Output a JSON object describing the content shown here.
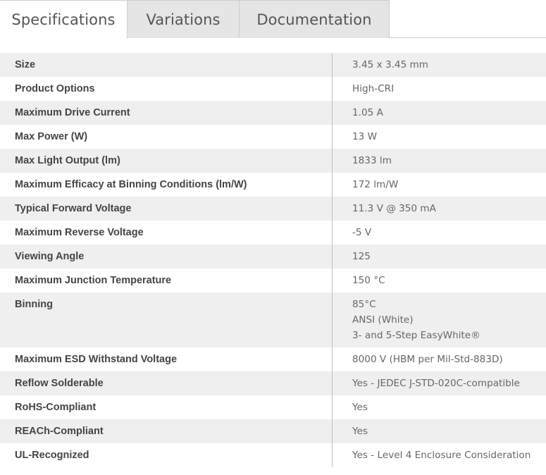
{
  "tabs": [
    {
      "label": "Specifications",
      "active": true
    },
    {
      "label": "Variations",
      "active": false
    },
    {
      "label": "Documentation",
      "active": false
    }
  ],
  "specs": [
    {
      "label": "Size",
      "values": [
        "3.45 x 3.45 mm"
      ]
    },
    {
      "label": "Product Options",
      "values": [
        "High-CRI"
      ]
    },
    {
      "label": "Maximum Drive Current",
      "values": [
        "1.05 A"
      ]
    },
    {
      "label": "Max Power (W)",
      "values": [
        "13 W"
      ]
    },
    {
      "label": "Max Light Output (lm)",
      "values": [
        "1833 lm"
      ]
    },
    {
      "label": "Maximum Efficacy at Binning Conditions (lm/W)",
      "values": [
        "172 lm/W"
      ]
    },
    {
      "label": "Typical Forward Voltage",
      "values": [
        "11.3 V @ 350 mA"
      ]
    },
    {
      "label": "Maximum Reverse Voltage",
      "values": [
        "-5 V"
      ]
    },
    {
      "label": "Viewing Angle",
      "values": [
        "125"
      ]
    },
    {
      "label": "Maximum Junction Temperature",
      "values": [
        "150 °C"
      ]
    },
    {
      "label": "Binning",
      "values": [
        "85°C",
        "ANSI (White)",
        "3- and 5-Step EasyWhite®"
      ]
    },
    {
      "label": "Maximum ESD Withstand Voltage",
      "values": [
        "8000 V (HBM per Mil-Std-883D)"
      ]
    },
    {
      "label": "Reflow Solderable",
      "values": [
        "Yes - JEDEC J-STD-020C-compatible"
      ]
    },
    {
      "label": "RoHS-Compliant",
      "values": [
        "Yes"
      ]
    },
    {
      "label": "REACh-Compliant",
      "values": [
        "Yes"
      ]
    },
    {
      "label": "UL-Recognized",
      "values": [
        "Yes - Level 4 Enclosure Consideration"
      ]
    }
  ]
}
